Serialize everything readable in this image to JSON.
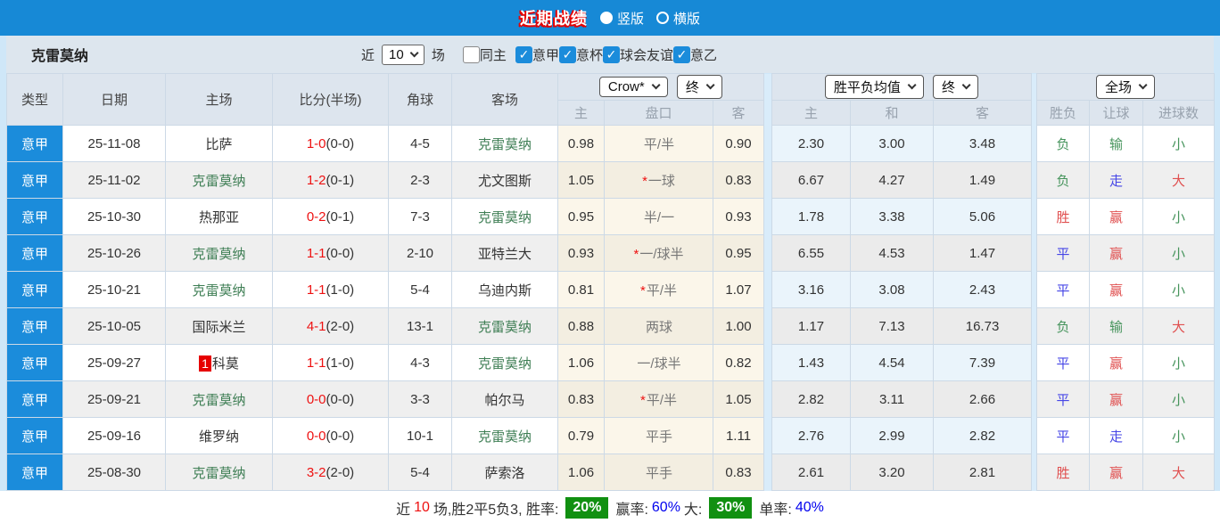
{
  "topbar": {
    "title": "近期战绩",
    "radio_vertical": "竖版",
    "radio_horizontal": "横版"
  },
  "filterbar": {
    "team": "克雷莫纳",
    "recent_label": "近",
    "recent_value": "10",
    "matches_label": "场",
    "checkboxes": [
      {
        "label": "同主",
        "checked": false
      },
      {
        "label": "意甲",
        "checked": true
      },
      {
        "label": "意杯",
        "checked": true
      },
      {
        "label": "球会友谊",
        "checked": true
      },
      {
        "label": "意乙",
        "checked": true
      }
    ]
  },
  "table": {
    "headers": {
      "type": "类型",
      "date": "日期",
      "home": "主场",
      "score": "比分(半场)",
      "corner": "角球",
      "away": "客场",
      "odds_company": "Crow*",
      "odds_state": "终",
      "avg_label": "胜平负均值",
      "avg_state": "终",
      "full_label": "全场",
      "sub_home": "主",
      "sub_pankou": "盘口",
      "sub_away": "客",
      "sub_avg_home": "主",
      "sub_avg_draw": "和",
      "sub_avg_away": "客",
      "sub_result": "胜负",
      "sub_handicap": "让球",
      "sub_goals": "进球数"
    },
    "rows": [
      {
        "league": "意甲",
        "date": "25-11-08",
        "home": {
          "name": "比萨",
          "green": false
        },
        "score_ft": "1-0",
        "score_ht": "(0-0)",
        "corner": "4-5",
        "away": {
          "name": "克雷莫纳",
          "green": true
        },
        "odds_home": "0.98",
        "pankou": {
          "star": false,
          "text": "平/半"
        },
        "odds_away": "0.90",
        "avg_home": "2.30",
        "avg_draw": "3.00",
        "avg_away": "3.48",
        "result": {
          "text": "负",
          "color": "green"
        },
        "handicap": {
          "text": "输",
          "color": "green"
        },
        "goals": {
          "text": "小",
          "color": "green"
        }
      },
      {
        "league": "意甲",
        "date": "25-11-02",
        "home": {
          "name": "克雷莫纳",
          "green": true
        },
        "score_ft": "1-2",
        "score_ht": "(0-1)",
        "corner": "2-3",
        "away": {
          "name": "尤文图斯",
          "green": false
        },
        "odds_home": "1.05",
        "pankou": {
          "star": true,
          "text": "一球"
        },
        "odds_away": "0.83",
        "avg_home": "6.67",
        "avg_draw": "4.27",
        "avg_away": "1.49",
        "result": {
          "text": "负",
          "color": "green"
        },
        "handicap": {
          "text": "走",
          "color": "blue"
        },
        "goals": {
          "text": "大",
          "color": "red"
        }
      },
      {
        "league": "意甲",
        "date": "25-10-30",
        "home": {
          "name": "热那亚",
          "green": false
        },
        "score_ft": "0-2",
        "score_ht": "(0-1)",
        "corner": "7-3",
        "away": {
          "name": "克雷莫纳",
          "green": true
        },
        "odds_home": "0.95",
        "pankou": {
          "star": false,
          "text": "半/一"
        },
        "odds_away": "0.93",
        "avg_home": "1.78",
        "avg_draw": "3.38",
        "avg_away": "5.06",
        "result": {
          "text": "胜",
          "color": "red"
        },
        "handicap": {
          "text": "赢",
          "color": "red"
        },
        "goals": {
          "text": "小",
          "color": "green"
        }
      },
      {
        "league": "意甲",
        "date": "25-10-26",
        "home": {
          "name": "克雷莫纳",
          "green": true
        },
        "score_ft": "1-1",
        "score_ht": "(0-0)",
        "corner": "2-10",
        "away": {
          "name": "亚特兰大",
          "green": false
        },
        "odds_home": "0.93",
        "pankou": {
          "star": true,
          "text": "一/球半"
        },
        "odds_away": "0.95",
        "avg_home": "6.55",
        "avg_draw": "4.53",
        "avg_away": "1.47",
        "result": {
          "text": "平",
          "color": "blue"
        },
        "handicap": {
          "text": "赢",
          "color": "red"
        },
        "goals": {
          "text": "小",
          "color": "green"
        }
      },
      {
        "league": "意甲",
        "date": "25-10-21",
        "home": {
          "name": "克雷莫纳",
          "green": true
        },
        "score_ft": "1-1",
        "score_ht": "(1-0)",
        "corner": "5-4",
        "away": {
          "name": "乌迪内斯",
          "green": false
        },
        "odds_home": "0.81",
        "pankou": {
          "star": true,
          "text": "平/半"
        },
        "odds_away": "1.07",
        "avg_home": "3.16",
        "avg_draw": "3.08",
        "avg_away": "2.43",
        "result": {
          "text": "平",
          "color": "blue"
        },
        "handicap": {
          "text": "赢",
          "color": "red"
        },
        "goals": {
          "text": "小",
          "color": "green"
        }
      },
      {
        "league": "意甲",
        "date": "25-10-05",
        "home": {
          "name": "国际米兰",
          "green": false
        },
        "score_ft": "4-1",
        "score_ht": "(2-0)",
        "corner": "13-1",
        "away": {
          "name": "克雷莫纳",
          "green": true
        },
        "odds_home": "0.88",
        "pankou": {
          "star": false,
          "text": "两球"
        },
        "odds_away": "1.00",
        "avg_home": "1.17",
        "avg_draw": "7.13",
        "avg_away": "16.73",
        "result": {
          "text": "负",
          "color": "green"
        },
        "handicap": {
          "text": "输",
          "color": "green"
        },
        "goals": {
          "text": "大",
          "color": "red"
        }
      },
      {
        "league": "意甲",
        "date": "25-09-27",
        "home": {
          "name": "科莫",
          "green": false,
          "badge": "1"
        },
        "score_ft": "1-1",
        "score_ht": "(1-0)",
        "corner": "4-3",
        "away": {
          "name": "克雷莫纳",
          "green": true
        },
        "odds_home": "1.06",
        "pankou": {
          "star": false,
          "text": "一/球半"
        },
        "odds_away": "0.82",
        "avg_home": "1.43",
        "avg_draw": "4.54",
        "avg_away": "7.39",
        "result": {
          "text": "平",
          "color": "blue"
        },
        "handicap": {
          "text": "赢",
          "color": "red"
        },
        "goals": {
          "text": "小",
          "color": "green"
        }
      },
      {
        "league": "意甲",
        "date": "25-09-21",
        "home": {
          "name": "克雷莫纳",
          "green": true
        },
        "score_ft": "0-0",
        "score_ht": "(0-0)",
        "corner": "3-3",
        "away": {
          "name": "帕尔马",
          "green": false
        },
        "odds_home": "0.83",
        "pankou": {
          "star": true,
          "text": "平/半"
        },
        "odds_away": "1.05",
        "avg_home": "2.82",
        "avg_draw": "3.11",
        "avg_away": "2.66",
        "result": {
          "text": "平",
          "color": "blue"
        },
        "handicap": {
          "text": "赢",
          "color": "red"
        },
        "goals": {
          "text": "小",
          "color": "green"
        }
      },
      {
        "league": "意甲",
        "date": "25-09-16",
        "home": {
          "name": "维罗纳",
          "green": false
        },
        "score_ft": "0-0",
        "score_ht": "(0-0)",
        "corner": "10-1",
        "away": {
          "name": "克雷莫纳",
          "green": true
        },
        "odds_home": "0.79",
        "pankou": {
          "star": false,
          "text": "平手"
        },
        "odds_away": "1.11",
        "avg_home": "2.76",
        "avg_draw": "2.99",
        "avg_away": "2.82",
        "result": {
          "text": "平",
          "color": "blue"
        },
        "handicap": {
          "text": "走",
          "color": "blue"
        },
        "goals": {
          "text": "小",
          "color": "green"
        }
      },
      {
        "league": "意甲",
        "date": "25-08-30",
        "home": {
          "name": "克雷莫纳",
          "green": true
        },
        "score_ft": "3-2",
        "score_ht": "(2-0)",
        "corner": "5-4",
        "away": {
          "name": "萨索洛",
          "green": false
        },
        "odds_home": "1.06",
        "pankou": {
          "star": false,
          "text": "平手"
        },
        "odds_away": "0.83",
        "avg_home": "2.61",
        "avg_draw": "3.20",
        "avg_away": "2.81",
        "result": {
          "text": "胜",
          "color": "red"
        },
        "handicap": {
          "text": "赢",
          "color": "red"
        },
        "goals": {
          "text": "大",
          "color": "red"
        }
      }
    ]
  },
  "footer": {
    "prefix": "近",
    "count": "10",
    "middle": "场,胜2平5负3, 胜率:",
    "win_rate": "20%",
    "win_pct_label": "赢率:",
    "win_pct": "60%",
    "big_label": "大:",
    "big_rate": "30%",
    "single_label": "单率:",
    "single_pct": "40%"
  },
  "colors": {
    "accent_blue": "#1b8cdb",
    "topbar_blue": "#1789d6",
    "score_red": "#ee1111",
    "team_green": "#3e7e54",
    "result_red": "#e05050",
    "result_green": "#46945c",
    "result_blue": "#4646e6",
    "badge_green": "#119011",
    "header_bg": "#dde5ee"
  }
}
